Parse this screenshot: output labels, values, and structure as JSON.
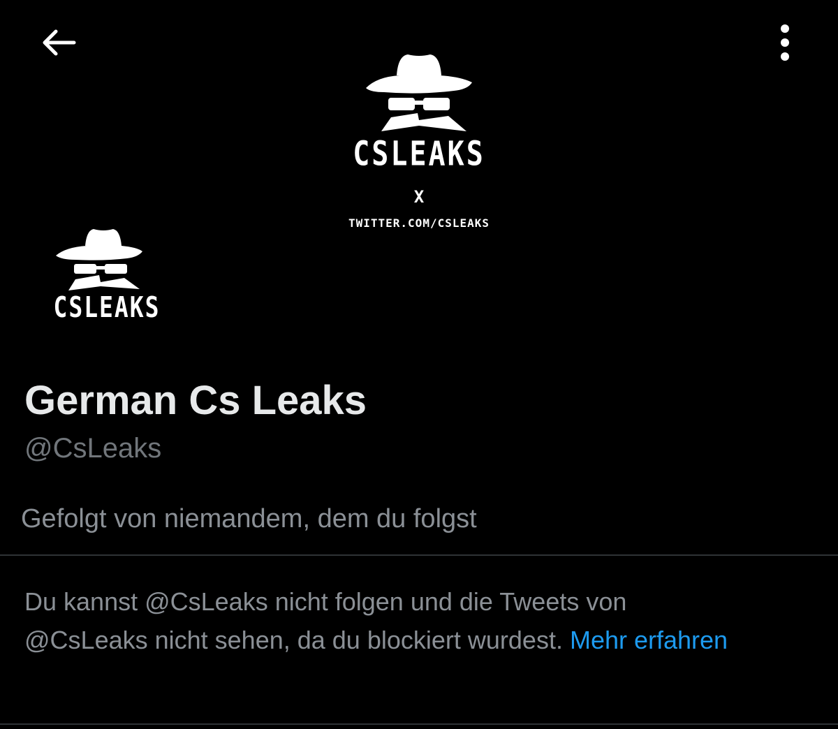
{
  "header": {
    "back_icon": "arrow-left-icon",
    "more_icon": "vertical-ellipsis-icon"
  },
  "banner": {
    "logo_icon": "spy-hat-glasses-icon",
    "brand": "CSLEAKS",
    "separator": "X",
    "url": "TWITTER.COM/CSLEAKS"
  },
  "avatar": {
    "logo_icon": "spy-hat-glasses-icon",
    "brand": "CSLEAKS"
  },
  "profile": {
    "display_name": "German Cs Leaks",
    "handle": "@CsLeaks",
    "followed_by": "Gefolgt von niemandem, dem du folgst"
  },
  "blocked": {
    "message": "Du kannst @CsLeaks nicht folgen und die Tweets von @CsLeaks nicht sehen, da du blockiert wurdest.",
    "link_label": "Mehr erfahren"
  },
  "colors": {
    "background": "#000000",
    "primary_text": "#e7e9ea",
    "secondary_text": "#71767b",
    "link": "#1d9bf0",
    "divider": "#2f3336"
  }
}
